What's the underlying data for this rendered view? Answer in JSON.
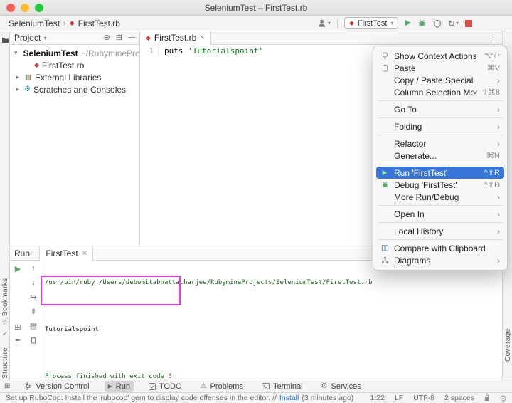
{
  "window": {
    "title": "SeleniumTest – FirstTest.rb"
  },
  "breadcrumbs": {
    "project": "SeleniumTest",
    "file": "FirstTest.rb"
  },
  "run_widget": {
    "config": "FirstTest"
  },
  "project_panel": {
    "title": "Project",
    "root_label": "SeleniumTest",
    "root_path": "~/RubymineProj",
    "file": "FirstTest.rb",
    "external_libraries": "External Libraries",
    "scratches": "Scratches and Consoles"
  },
  "editor": {
    "tab": "FirstTest.rb",
    "line_no": "1",
    "code_call": "puts ",
    "code_string": "'Tutorialspoint'"
  },
  "context_menu": {
    "items": [
      {
        "label": "Show Context Actions",
        "shortcut": "⌥↩"
      },
      {
        "label": "Paste",
        "shortcut": "⌘V"
      },
      {
        "label": "Copy / Paste Special",
        "has_submenu": true
      },
      {
        "label": "Column Selection Mode",
        "shortcut": "⇧⌘8"
      },
      {
        "label": "Go To",
        "has_submenu": true
      },
      {
        "label": "Folding",
        "has_submenu": true
      },
      {
        "label": "Refactor",
        "has_submenu": true
      },
      {
        "label": "Generate...",
        "shortcut": "⌘N"
      },
      {
        "label": "Run 'FirstTest'",
        "shortcut": "^⇧R",
        "selected": true
      },
      {
        "label": "Debug 'FirstTest'",
        "shortcut": "^⇧D"
      },
      {
        "label": "More Run/Debug",
        "has_submenu": true
      },
      {
        "label": "Open In",
        "has_submenu": true
      },
      {
        "label": "Local History",
        "has_submenu": true
      },
      {
        "label": "Compare with Clipboard"
      },
      {
        "label": "Diagrams",
        "has_submenu": true
      }
    ]
  },
  "run_panel": {
    "label": "Run:",
    "tab": "FirstTest",
    "console": [
      "/usr/bin/ruby /Users/debomitabhattacharjee/RubymineProjects/SeleniumTest/FirstTest.rb",
      "",
      "Tutorialspoint",
      "",
      "Process finished with exit code 0"
    ]
  },
  "bottom_bar": {
    "items": [
      "Version Control",
      "Run",
      "TODO",
      "Problems",
      "Terminal",
      "Services"
    ],
    "active": "Run"
  },
  "status_bar": {
    "message": "Set up RuboCop: Install the 'rubocop' gem to display code offenses in the editor. //",
    "action": "Install",
    "ago": "(3 minutes ago)",
    "caret": "1:22",
    "line_sep": "LF",
    "encoding": "UTF-8",
    "indent": "2 spaces"
  },
  "stripes": {
    "bookmarks": "Bookmarks",
    "structure": "Structure",
    "coverage": "Coverage"
  },
  "icons": {
    "chevron_down": "▾",
    "chevron_right": "›",
    "tree_collapsed": "▸",
    "tree_expanded": "▾",
    "close": "×",
    "play": "▶",
    "ruby_gem": "◆",
    "locate": "⊕",
    "collapse_all": "⊟",
    "hide": "—",
    "kebab": "⋮",
    "up": "↑",
    "down": "↓",
    "soft_wrap": "↪",
    "scroll_end": "⇟",
    "print": "▤",
    "restore_layout": "⊞",
    "pin": "≡",
    "rerun": "↻",
    "warning": "⚠",
    "gear": "⚙",
    "star": "☆",
    "check": "✓",
    "quick_access": "⊞",
    "breadcrumb_sep": "›"
  },
  "colors": {
    "selection_blue": "#3875d7",
    "run_green": "#59a869",
    "stop_red": "#d5504a",
    "ruby_red": "#c4413b",
    "annotation_magenta": "#e83ae8",
    "string_green": "#067d17"
  }
}
